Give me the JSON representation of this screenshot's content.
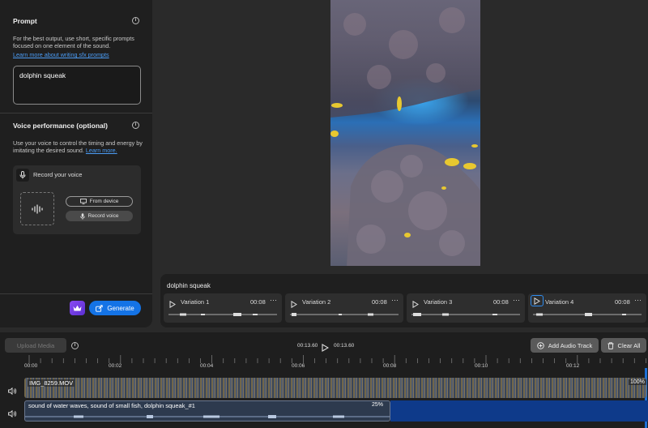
{
  "left_panel": {
    "prompt_title": "Prompt",
    "prompt_help": "For the best output, use short, specific prompts focused on one element of the sound.",
    "prompt_link": "Learn more about writing sfx prompts",
    "prompt_value": "dolphin squeak",
    "voice_title": "Voice performance (optional)",
    "voice_help": "Use your voice to control the timing and energy by imitating the desired sound.",
    "voice_link": "Learn more.",
    "record_label": "Record your voice",
    "from_device": "From device",
    "record_voice": "Record voice",
    "generate": "Generate"
  },
  "variations": {
    "prompt": "dolphin squeak",
    "items": [
      {
        "label": "Variation 1",
        "time": "00:08"
      },
      {
        "label": "Variation 2",
        "time": "00:08"
      },
      {
        "label": "Variation 3",
        "time": "00:08"
      },
      {
        "label": "Variation 4",
        "time": "00:08"
      }
    ]
  },
  "timeline": {
    "upload_media": "Upload Media",
    "current_time": "00:13.60",
    "total_time": "00:13.60",
    "add_audio_track": "Add Audio Track",
    "clear_all": "Clear All",
    "ticks": [
      "00:00",
      "00:02",
      "00:04",
      "00:06",
      "00:08",
      "00:10",
      "00:12"
    ],
    "track1_name": "IMG_8259.MOV",
    "track1_volume": "100%",
    "track2_name": "sound of water waves, sound of small fish, dolphin squeak_#1",
    "track2_volume": "25%"
  },
  "colors": {
    "accent": "#1473e6",
    "link": "#4b9cf5",
    "panel": "#1f1f1f"
  }
}
